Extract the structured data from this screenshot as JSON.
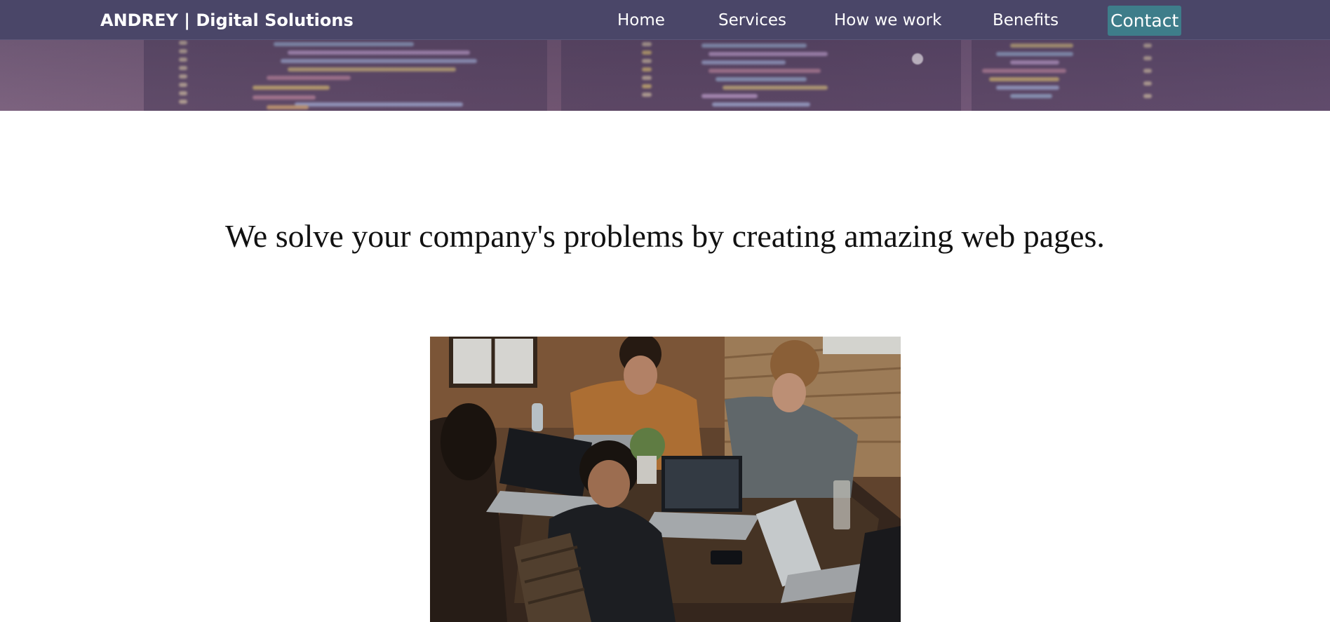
{
  "header": {
    "brand": "ANDREY | Digital Solutions",
    "nav": [
      {
        "label": "Home",
        "active": false
      },
      {
        "label": "Services",
        "active": false
      },
      {
        "label": "How we work",
        "active": false
      },
      {
        "label": "Benefits",
        "active": false
      },
      {
        "label": "Contact",
        "active": true
      }
    ]
  },
  "hero": {
    "image": "code-on-monitors-banner"
  },
  "main": {
    "headline": "We solve your company's problems by creating amazing web pages.",
    "image": "team-working-on-laptops-photo"
  },
  "colors": {
    "navbar": "#4a4668",
    "active_nav": "#3e7d8a",
    "text": "#111111"
  }
}
